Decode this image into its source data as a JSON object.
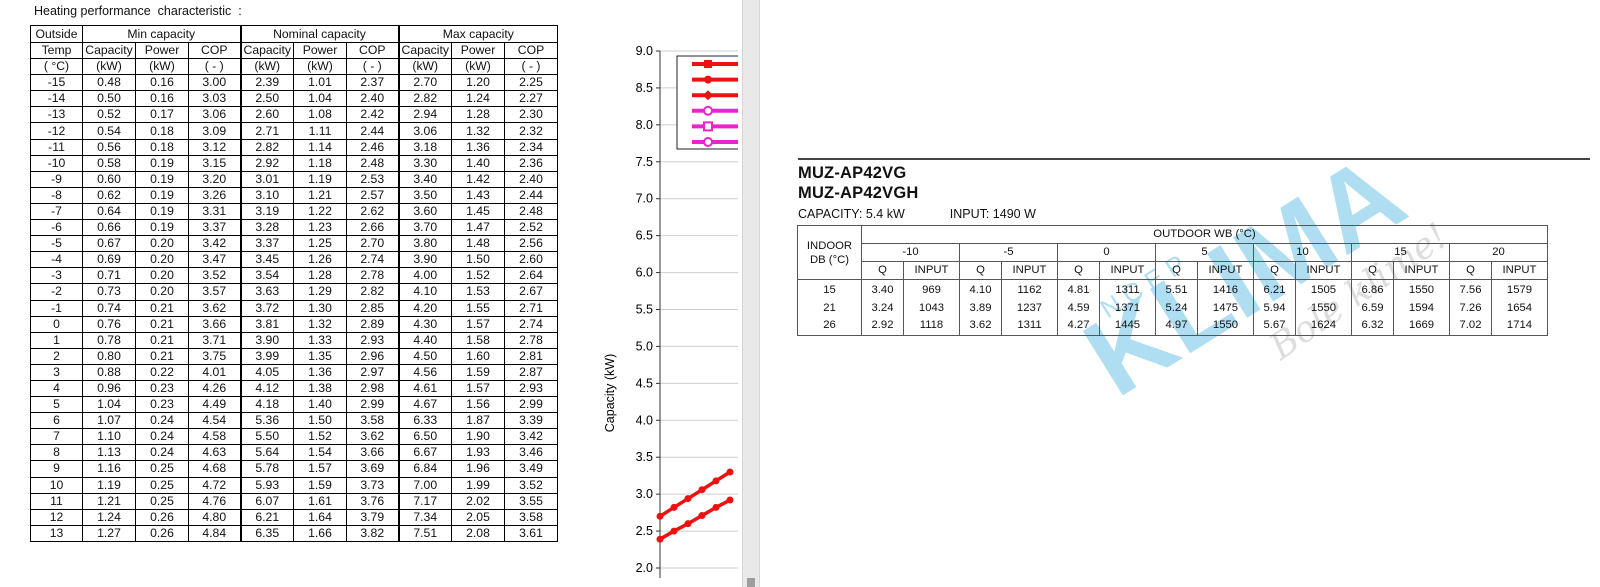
{
  "left": {
    "heading": "Heating performance  characteristic  :",
    "table": {
      "group_headers": [
        "Min capacity",
        "Nominal capacity",
        "Max capacity"
      ],
      "corner": [
        "Outside",
        "Temp",
        "( °C)"
      ],
      "sub_headers": [
        "Capacity",
        "Power",
        "COP",
        "Capacity",
        "Power",
        "COP",
        "Capacity",
        "Power",
        "COP"
      ],
      "units": [
        "(kW)",
        "(kW)",
        "( - )",
        "(kW)",
        "(kW)",
        "( - )",
        "(kW)",
        "(kW)",
        "( - )"
      ],
      "rows": [
        [
          "-15",
          "0.48",
          "0.16",
          "3.00",
          "2.39",
          "1.01",
          "2.37",
          "2.70",
          "1.20",
          "2.25"
        ],
        [
          "-14",
          "0.50",
          "0.16",
          "3.03",
          "2.50",
          "1.04",
          "2.40",
          "2.82",
          "1.24",
          "2.27"
        ],
        [
          "-13",
          "0.52",
          "0.17",
          "3.06",
          "2.60",
          "1.08",
          "2.42",
          "2.94",
          "1.28",
          "2.30"
        ],
        [
          "-12",
          "0.54",
          "0.18",
          "3.09",
          "2.71",
          "1.11",
          "2.44",
          "3.06",
          "1.32",
          "2.32"
        ],
        [
          "-11",
          "0.56",
          "0.18",
          "3.12",
          "2.82",
          "1.14",
          "2.46",
          "3.18",
          "1.36",
          "2.34"
        ],
        [
          "-10",
          "0.58",
          "0.19",
          "3.15",
          "2.92",
          "1.18",
          "2.48",
          "3.30",
          "1.40",
          "2.36"
        ],
        [
          "-9",
          "0.60",
          "0.19",
          "3.20",
          "3.01",
          "1.19",
          "2.53",
          "3.40",
          "1.42",
          "2.40"
        ],
        [
          "-8",
          "0.62",
          "0.19",
          "3.26",
          "3.10",
          "1.21",
          "2.57",
          "3.50",
          "1.43",
          "2.44"
        ],
        [
          "-7",
          "0.64",
          "0.19",
          "3.31",
          "3.19",
          "1.22",
          "2.62",
          "3.60",
          "1.45",
          "2.48"
        ],
        [
          "-6",
          "0.66",
          "0.19",
          "3.37",
          "3.28",
          "1.23",
          "2.66",
          "3.70",
          "1.47",
          "2.52"
        ],
        [
          "-5",
          "0.67",
          "0.20",
          "3.42",
          "3.37",
          "1.25",
          "2.70",
          "3.80",
          "1.48",
          "2.56"
        ],
        [
          "-4",
          "0.69",
          "0.20",
          "3.47",
          "3.45",
          "1.26",
          "2.74",
          "3.90",
          "1.50",
          "2.60"
        ],
        [
          "-3",
          "0.71",
          "0.20",
          "3.52",
          "3.54",
          "1.28",
          "2.78",
          "4.00",
          "1.52",
          "2.64"
        ],
        [
          "-2",
          "0.73",
          "0.20",
          "3.57",
          "3.63",
          "1.29",
          "2.82",
          "4.10",
          "1.53",
          "2.67"
        ],
        [
          "-1",
          "0.74",
          "0.21",
          "3.62",
          "3.72",
          "1.30",
          "2.85",
          "4.20",
          "1.55",
          "2.71"
        ],
        [
          "0",
          "0.76",
          "0.21",
          "3.66",
          "3.81",
          "1.32",
          "2.89",
          "4.30",
          "1.57",
          "2.74"
        ],
        [
          "1",
          "0.78",
          "0.21",
          "3.71",
          "3.90",
          "1.33",
          "2.93",
          "4.40",
          "1.58",
          "2.78"
        ],
        [
          "2",
          "0.80",
          "0.21",
          "3.75",
          "3.99",
          "1.35",
          "2.96",
          "4.50",
          "1.60",
          "2.81"
        ],
        [
          "3",
          "0.88",
          "0.22",
          "4.01",
          "4.05",
          "1.36",
          "2.97",
          "4.56",
          "1.59",
          "2.87"
        ],
        [
          "4",
          "0.96",
          "0.23",
          "4.26",
          "4.12",
          "1.38",
          "2.98",
          "4.61",
          "1.57",
          "2.93"
        ],
        [
          "5",
          "1.04",
          "0.23",
          "4.49",
          "4.18",
          "1.40",
          "2.99",
          "4.67",
          "1.56",
          "2.99"
        ],
        [
          "6",
          "1.07",
          "0.24",
          "4.54",
          "5.36",
          "1.50",
          "3.58",
          "6.33",
          "1.87",
          "3.39"
        ],
        [
          "7",
          "1.10",
          "0.24",
          "4.58",
          "5.50",
          "1.52",
          "3.62",
          "6.50",
          "1.90",
          "3.42"
        ],
        [
          "8",
          "1.13",
          "0.24",
          "4.63",
          "5.64",
          "1.54",
          "3.66",
          "6.67",
          "1.93",
          "3.46"
        ],
        [
          "9",
          "1.16",
          "0.25",
          "4.68",
          "5.78",
          "1.57",
          "3.69",
          "6.84",
          "1.96",
          "3.49"
        ],
        [
          "10",
          "1.19",
          "0.25",
          "4.72",
          "5.93",
          "1.59",
          "3.73",
          "7.00",
          "1.99",
          "3.52"
        ],
        [
          "11",
          "1.21",
          "0.25",
          "4.76",
          "6.07",
          "1.61",
          "3.76",
          "7.17",
          "2.02",
          "3.55"
        ],
        [
          "12",
          "1.24",
          "0.26",
          "4.80",
          "6.21",
          "1.64",
          "3.79",
          "7.34",
          "2.05",
          "3.58"
        ],
        [
          "13",
          "1.27",
          "0.26",
          "4.84",
          "6.35",
          "1.66",
          "3.82",
          "7.51",
          "2.08",
          "3.61"
        ]
      ]
    }
  },
  "chart_data": {
    "type": "line",
    "ylabel": "Capacity (kW)",
    "ylim": [
      2.0,
      9.0
    ],
    "yticks": [
      "9.0",
      "8.5",
      "8.0",
      "7.5",
      "7.0",
      "6.5",
      "6.0",
      "5.5",
      "5.0",
      "4.5",
      "4.0",
      "3.5",
      "3.0",
      "2.5",
      "2.0"
    ],
    "grid": true,
    "legend_position": "top-right",
    "legend_colors": [
      "#ee1111",
      "#ee1111",
      "#ee1111",
      "#ee22cc",
      "#ee22cc",
      "#ee22cc"
    ],
    "series_visible": [
      {
        "color": "#ee1111",
        "x": [
          -15,
          -14,
          -13,
          -12,
          -11,
          -10
        ],
        "values": [
          2.7,
          2.82,
          2.94,
          3.06,
          3.18,
          3.3
        ]
      },
      {
        "color": "#ee1111",
        "x": [
          -15,
          -14,
          -13,
          -12,
          -11,
          -10
        ],
        "values": [
          2.39,
          2.5,
          2.6,
          2.71,
          2.82,
          2.92
        ]
      }
    ]
  },
  "right": {
    "model_1": "MUZ-AP42VG",
    "model_2": "MUZ-AP42VGH",
    "capacity_label": "CAPACITY: 5.4 kW",
    "input_label": "INPUT: 1490 W",
    "table": {
      "indoor_label_1": "INDOOR",
      "indoor_label_2": "DB (°C)",
      "outdoor_label": "OUTDOOR WB (°C)",
      "wb_values": [
        "-10",
        "-5",
        "0",
        "5",
        "10",
        "15",
        "20"
      ],
      "q_label": "Q",
      "input_col_label": "INPUT",
      "rows": [
        {
          "db": "15",
          "cells": [
            "3.40",
            "969",
            "4.10",
            "1162",
            "4.81",
            "1311",
            "5.51",
            "1416",
            "6.21",
            "1505",
            "6.86",
            "1550",
            "7.56",
            "1579"
          ]
        },
        {
          "db": "21",
          "cells": [
            "3.24",
            "1043",
            "3.89",
            "1237",
            "4.59",
            "1371",
            "5.24",
            "1475",
            "5.94",
            "1550",
            "6.59",
            "1594",
            "7.26",
            "1654"
          ]
        },
        {
          "db": "26",
          "cells": [
            "2.92",
            "1118",
            "3.62",
            "1311",
            "4.27",
            "1445",
            "4.97",
            "1550",
            "5.67",
            "1624",
            "6.32",
            "1669",
            "7.02",
            "1714"
          ]
        }
      ]
    },
    "watermark": {
      "letters": "KLIMA",
      "sub": "N  C  E  P",
      "script": "Bole klime!",
      "color": "#6fc4ea"
    }
  }
}
